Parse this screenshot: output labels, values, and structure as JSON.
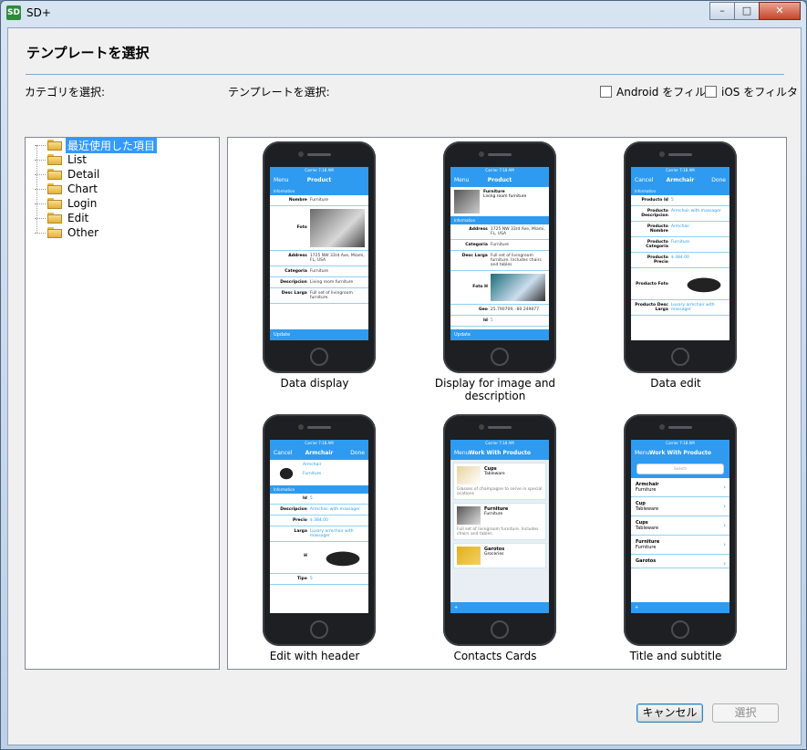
{
  "window": {
    "title": "SD+",
    "app_icon": "SD",
    "min_icon": "–",
    "max_icon": "□",
    "close_icon": "✕"
  },
  "dialog": {
    "title": "テンプレートを選択",
    "category_label": "カテゴリを選択:",
    "template_label": "テンプレートを選択:",
    "filter_android": "Android をフィルタ",
    "filter_ios": "iOS をフィルタ"
  },
  "categories": [
    "最近使用した項目",
    "List",
    "Detail",
    "Chart",
    "Login",
    "Edit",
    "Other"
  ],
  "templates": [
    {
      "caption": "Data display",
      "nav_left": "Menu",
      "nav_title": "Product",
      "nav_right": ""
    },
    {
      "caption": "Display for image and description",
      "nav_left": "Menu",
      "nav_title": "Product",
      "nav_right": ""
    },
    {
      "caption": "Data edit",
      "nav_left": "Cancel",
      "nav_title": "Armchair",
      "nav_right": "Done"
    },
    {
      "caption": "Edit with header",
      "nav_left": "Cancel",
      "nav_title": "Armchair",
      "nav_right": "Done"
    },
    {
      "caption": "Contacts Cards",
      "nav_left": "Menu",
      "nav_title": "Work With Producto",
      "nav_right": ""
    },
    {
      "caption": "Title and subtitle",
      "nav_left": "Menu",
      "nav_title": "Work With Producto",
      "nav_right": ""
    }
  ],
  "phone": {
    "status": "Carrier  7:18 AM",
    "info": "Information",
    "update": "Update",
    "search": "Search",
    "t1_rows": [
      [
        "Nombre",
        "Furniture"
      ],
      [
        "Foto",
        ""
      ],
      [
        "Address",
        "1725 NW 33rd Ave, Miami, FL, USA"
      ],
      [
        "Categoria",
        "Furniture"
      ],
      [
        "Descripcion",
        "Living room furniture"
      ],
      [
        "Desc Larga",
        "Full set of livingroom furniture."
      ]
    ],
    "t2_header": [
      "Furniture",
      "Living room furniture"
    ],
    "t2_rows": [
      [
        "Address",
        "1725 NW 33rd Ave, Miami, FL, USA"
      ],
      [
        "Categoria",
        "Furniture"
      ],
      [
        "Desc Larga",
        "Full set of livingroom furniture. Includes chairs and tables"
      ],
      [
        "Foto H",
        ""
      ],
      [
        "Geo",
        "25.790709, -80.249877"
      ],
      [
        "Id",
        "5"
      ]
    ],
    "t3_rows": [
      [
        "Producto Id",
        "5"
      ],
      [
        "Producto Descripcion",
        "Armchair with massager"
      ],
      [
        "Producto Nombre",
        "Armchair"
      ],
      [
        "Producto Categoria",
        "Furniture"
      ],
      [
        "Producto Precio",
        "$ 384.00"
      ],
      [
        "Producto Foto",
        ""
      ],
      [
        "Producto Desc Larga",
        "Luxary armchair with massager"
      ]
    ],
    "t4_header": [
      "Armchair",
      "Furniture"
    ],
    "t4_rows": [
      [
        "Id",
        "5"
      ],
      [
        "Descripcion",
        "Armchair with massager"
      ],
      [
        "Precio",
        "$ 384.00"
      ],
      [
        "Larga",
        "Luxary armchair with massager"
      ],
      [
        "H",
        ""
      ],
      [
        "Tipo",
        "5"
      ]
    ],
    "t5_cards": [
      [
        "Cups",
        "Tableware",
        "Glasses of champagne to serve in special ocations"
      ],
      [
        "Furniture",
        "Furniture",
        "Full set of livingroom furniture. Includes chairs and tables"
      ],
      [
        "Garotos",
        "Groceries",
        ""
      ]
    ],
    "t6_rows": [
      [
        "Armchair",
        "Furniture"
      ],
      [
        "Cup",
        "Tableware"
      ],
      [
        "Cups",
        "Tableware"
      ],
      [
        "Furniture",
        "Furniture"
      ],
      [
        "Garotos",
        ""
      ]
    ]
  },
  "buttons": {
    "cancel": "キャンセル",
    "select": "選択"
  }
}
